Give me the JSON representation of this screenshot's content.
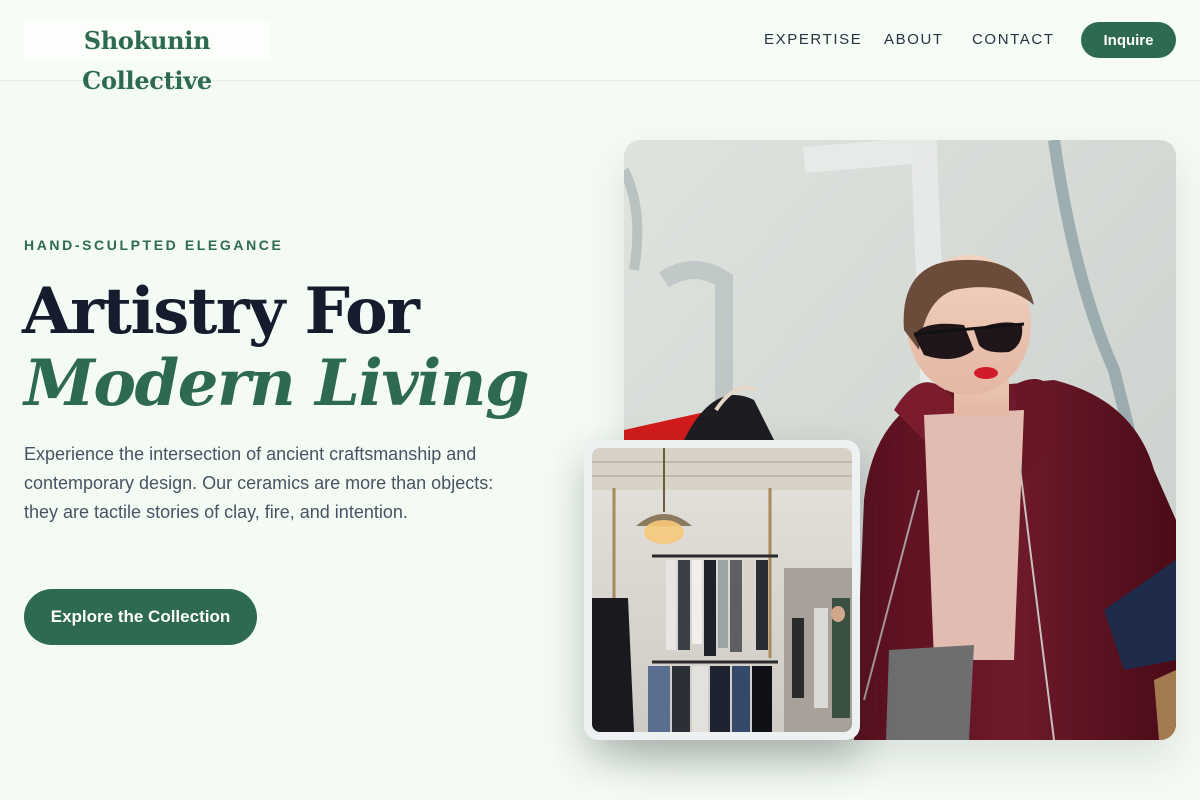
{
  "header": {
    "logo": "Shokunin Collective",
    "nav": [
      "EXPERTISE",
      "ABOUT",
      "CONTACT"
    ],
    "inquire_label": "Inquire"
  },
  "hero": {
    "eyebrow": "HAND-SCULPTED ELEGANCE",
    "headline_line1": "Artistry For",
    "headline_line2": "Modern Living",
    "lede": "Experience the intersection of ancient craftsmanship and contemporary design. Our ceramics are more than objects: they are tactile stories of clay, fire, and intention.",
    "cta_label": "Explore the Collection"
  },
  "colors": {
    "accent": "#2d6a4f",
    "background": "#f4fbf4",
    "ink": "#141c2e"
  },
  "images": {
    "hero": "woman-in-burgundy-coat-photo",
    "inset": "clothing-store-interior-photo"
  }
}
